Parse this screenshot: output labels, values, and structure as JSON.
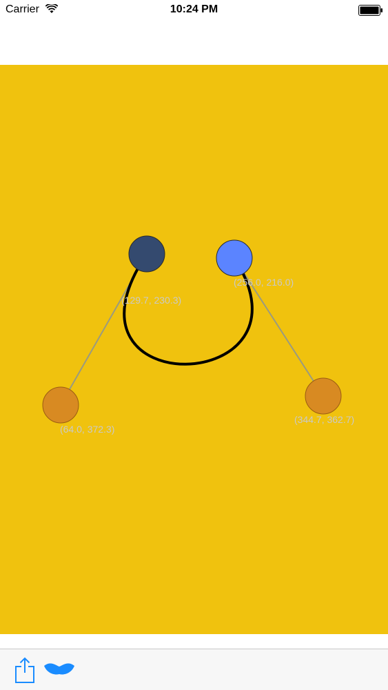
{
  "status_bar": {
    "carrier": "Carrier",
    "time": "10:24 PM",
    "icons": [
      "wifi-icon",
      "battery-icon"
    ]
  },
  "canvas": {
    "background_color": "#f0c20e",
    "curve_color": "#000000",
    "control_line_color": "#9a9a80",
    "points": [
      {
        "name": "start-point",
        "label": "(129.7, 230.3)",
        "color": "#344a6f"
      },
      {
        "name": "end-point",
        "label": "(256.0, 216.0)",
        "color": "#5b84ff"
      },
      {
        "name": "control-point-1",
        "label": "(64.0, 372.3)",
        "color": "#d88a22"
      },
      {
        "name": "control-point-2",
        "label": "(344.7, 362.7)",
        "color": "#d88a22"
      }
    ]
  },
  "toolbar": {
    "icons": [
      "share-icon",
      "shape-icon"
    ],
    "accent_color": "#1a8cff"
  }
}
